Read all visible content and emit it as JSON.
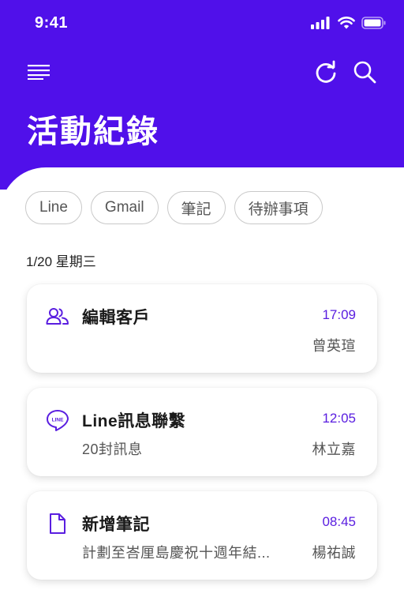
{
  "status_bar": {
    "time": "9:41"
  },
  "header": {
    "title": "活動紀錄",
    "background_color": "#5010ea",
    "icons": [
      "menu-icon",
      "refresh-icon",
      "search-icon"
    ]
  },
  "filters": [
    "Line",
    "Gmail",
    "筆記",
    "待辦事項"
  ],
  "date_label": "1/20 星期三",
  "activities": [
    {
      "icon": "people-icon",
      "title": "編輯客戶",
      "time": "17:09",
      "subtitle": "",
      "person": "曾英瑄"
    },
    {
      "icon": "line-icon",
      "title": "Line訊息聯繫",
      "time": "12:05",
      "subtitle": "20封訊息",
      "person": "林立嘉"
    },
    {
      "icon": "document-icon",
      "title": "新增筆記",
      "time": "08:45",
      "subtitle": "計劃至峇厘島慶祝十週年結...",
      "person": "楊祐誠"
    }
  ],
  "accent_color": "#5a1ee0"
}
